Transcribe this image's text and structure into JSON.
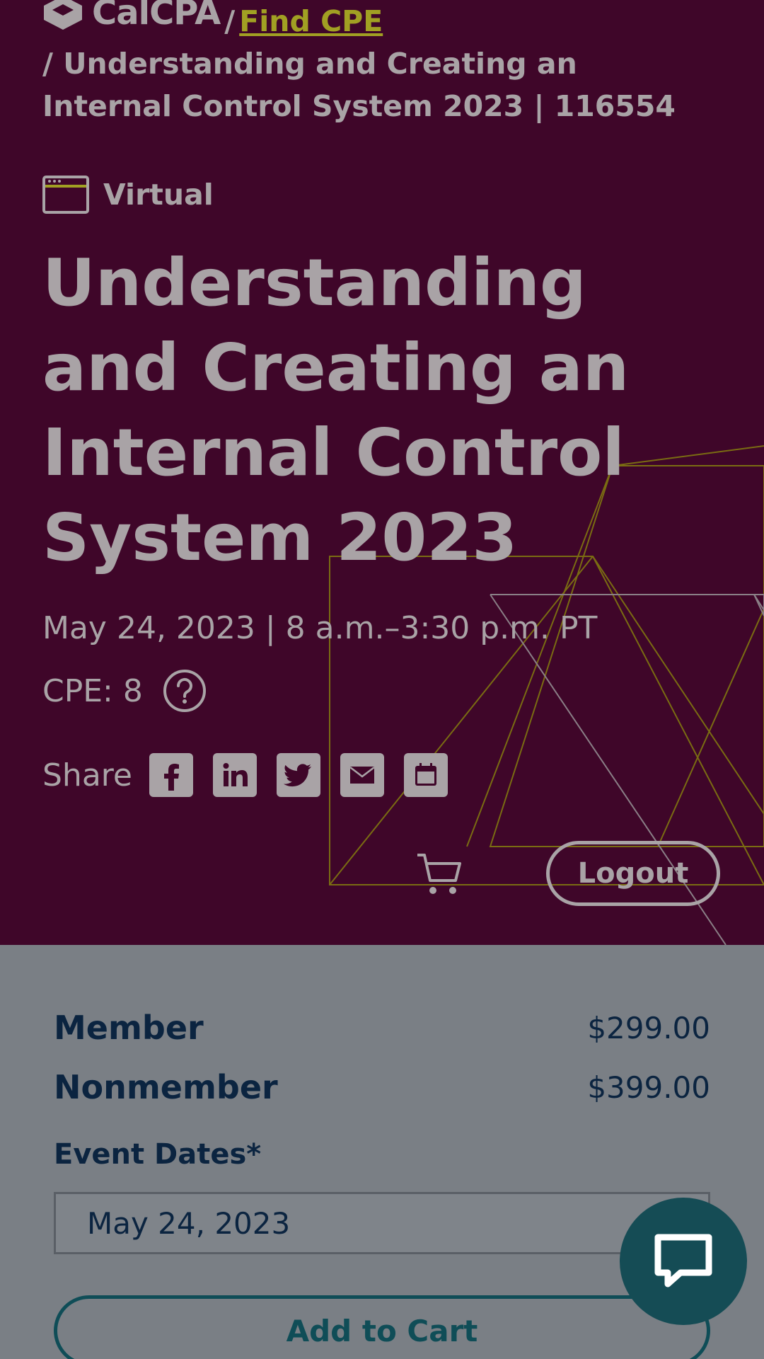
{
  "breadcrumb": {
    "logo_text": "CalCPA",
    "separator": "/",
    "link_label": "Find CPE",
    "current": "/ Understanding and Creating an Internal Control System 2023 | 116554"
  },
  "event": {
    "format_label": "Virtual",
    "title": "Understanding and Creating an Internal Control System 2023",
    "date_time": "May 24, 2023 | 8 a.m.–3:30 p.m. PT",
    "cpe_label": "CPE: 8"
  },
  "share": {
    "label": "Share",
    "icons": [
      "facebook-icon",
      "linkedin-icon",
      "twitter-icon",
      "email-icon",
      "calendar-icon"
    ]
  },
  "header_actions": {
    "logout_label": "Logout"
  },
  "pricing": {
    "rows": [
      {
        "label": "Member",
        "price": "$299.00"
      },
      {
        "label": "Nonmember",
        "price": "$399.00"
      }
    ]
  },
  "event_dates": {
    "label": "Event Dates*",
    "selected": "May 24, 2023"
  },
  "actions": {
    "add_to_cart_label": "Add to Cart"
  },
  "colors": {
    "hero_background": "#3f0629",
    "link_accent": "#a1a023",
    "panel_background": "#7a7f85",
    "text_dark": "#0b2440",
    "teal_accent": "#154c55"
  }
}
